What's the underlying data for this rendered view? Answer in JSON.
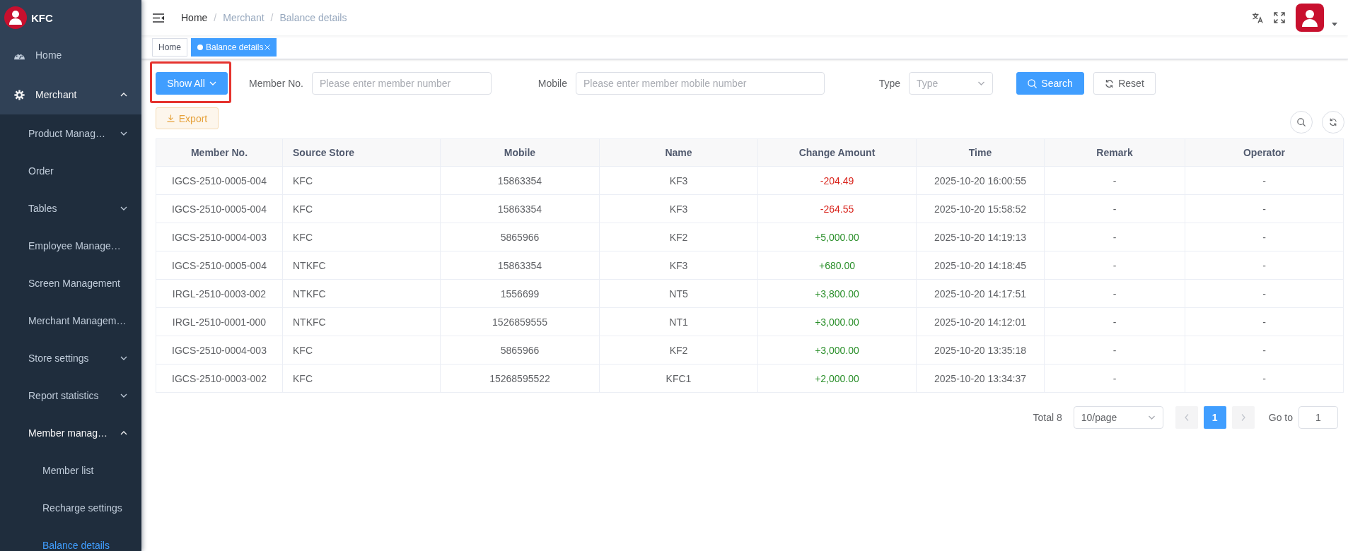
{
  "sidebar": {
    "brand": "KFC",
    "items": [
      {
        "kind": "link",
        "label": "Home",
        "selected": false
      },
      {
        "kind": "submenu",
        "label": "Merchant",
        "expanded": true,
        "children": [
          {
            "kind": "submenu",
            "label": "Product Manag…",
            "expanded": false
          },
          {
            "kind": "link",
            "label": "Order",
            "selected": false
          },
          {
            "kind": "submenu",
            "label": "Tables",
            "expanded": false
          },
          {
            "kind": "link",
            "label": "Employee Manage…",
            "selected": false
          },
          {
            "kind": "link",
            "label": "Screen Management",
            "selected": false
          },
          {
            "kind": "link",
            "label": "Merchant Managem…",
            "selected": false
          },
          {
            "kind": "submenu",
            "label": "Store settings",
            "expanded": false
          },
          {
            "kind": "submenu",
            "label": "Report statistics",
            "expanded": false
          },
          {
            "kind": "submenu",
            "label": "Member manag…",
            "expanded": true,
            "children": [
              {
                "kind": "link",
                "label": "Member list",
                "selected": false
              },
              {
                "kind": "link",
                "label": "Recharge settings",
                "selected": false
              },
              {
                "kind": "link",
                "label": "Balance details",
                "selected": true
              }
            ]
          }
        ]
      }
    ]
  },
  "header": {
    "breadcrumb": [
      {
        "label": "Home",
        "link": true
      },
      {
        "separator": "/",
        "label": "Merchant",
        "link": false
      },
      {
        "separator": "/",
        "label": "Balance details",
        "link": false
      }
    ]
  },
  "tags": [
    {
      "label": "Home",
      "selected": false,
      "closable": false
    },
    {
      "label": "Balance details",
      "selected": true,
      "closable": true
    }
  ],
  "filters": {
    "show_all": {
      "label": "Show All",
      "highlighted": true
    },
    "fields": [
      {
        "kind": "input",
        "label": "Member No.",
        "placeholder": "Please enter member number"
      },
      {
        "kind": "input",
        "label": "Mobile",
        "placeholder": "Please enter member mobile number"
      },
      {
        "kind": "select",
        "label": "Type",
        "placeholder": "Type"
      }
    ],
    "buttons": [
      {
        "kind": "primary",
        "label": "Search"
      },
      {
        "kind": "default",
        "label": "Reset"
      }
    ]
  },
  "toolbar": {
    "export": "Export"
  },
  "table": {
    "columns": [
      "Member No.",
      "Source Store",
      "Mobile",
      "Name",
      "Change Amount",
      "Time",
      "Remark",
      "Operator"
    ],
    "rows": [
      {
        "kind": "debit",
        "cells": [
          "IGCS-2510-0005-004",
          "KFC",
          "15863354",
          "KF3",
          "-204.49",
          "2025-10-20 16:00:55",
          "-",
          "-"
        ]
      },
      {
        "kind": "debit",
        "cells": [
          "IGCS-2510-0005-004",
          "KFC",
          "15863354",
          "KF3",
          "-264.55",
          "2025-10-20 15:58:52",
          "-",
          "-"
        ]
      },
      {
        "kind": "credit",
        "cells": [
          "IGCS-2510-0004-003",
          "KFC",
          "5865966",
          "KF2",
          "+5,000.00",
          "2025-10-20 14:19:13",
          "-",
          "-"
        ]
      },
      {
        "kind": "credit",
        "cells": [
          "IGCS-2510-0005-004",
          "NTKFC",
          "15863354",
          "KF3",
          "+680.00",
          "2025-10-20 14:18:45",
          "-",
          "-"
        ]
      },
      {
        "kind": "credit",
        "cells": [
          "IRGL-2510-0003-002",
          "NTKFC",
          "1556699",
          "NT5",
          "+3,800.00",
          "2025-10-20 14:17:51",
          "-",
          "-"
        ]
      },
      {
        "kind": "credit",
        "cells": [
          "IRGL-2510-0001-000",
          "NTKFC",
          "1526859555",
          "NT1",
          "+3,000.00",
          "2025-10-20 14:12:01",
          "-",
          "-"
        ]
      },
      {
        "kind": "credit",
        "cells": [
          "IGCS-2510-0004-003",
          "KFC",
          "5865966",
          "KF2",
          "+3,000.00",
          "2025-10-20 13:35:18",
          "-",
          "-"
        ]
      },
      {
        "kind": "credit",
        "cells": [
          "IGCS-2510-0003-002",
          "KFC",
          "15268595522",
          "KFC1",
          "+2,000.00",
          "2025-10-20 13:34:37",
          "-",
          "-"
        ]
      }
    ]
  },
  "pagination": {
    "total": "Total 8",
    "page_size": "10/page",
    "prev_disabled": true,
    "next_disabled": true,
    "pages": [
      {
        "label": "1",
        "selected": true
      }
    ],
    "goto_label": "Go to",
    "goto_value": "1"
  }
}
